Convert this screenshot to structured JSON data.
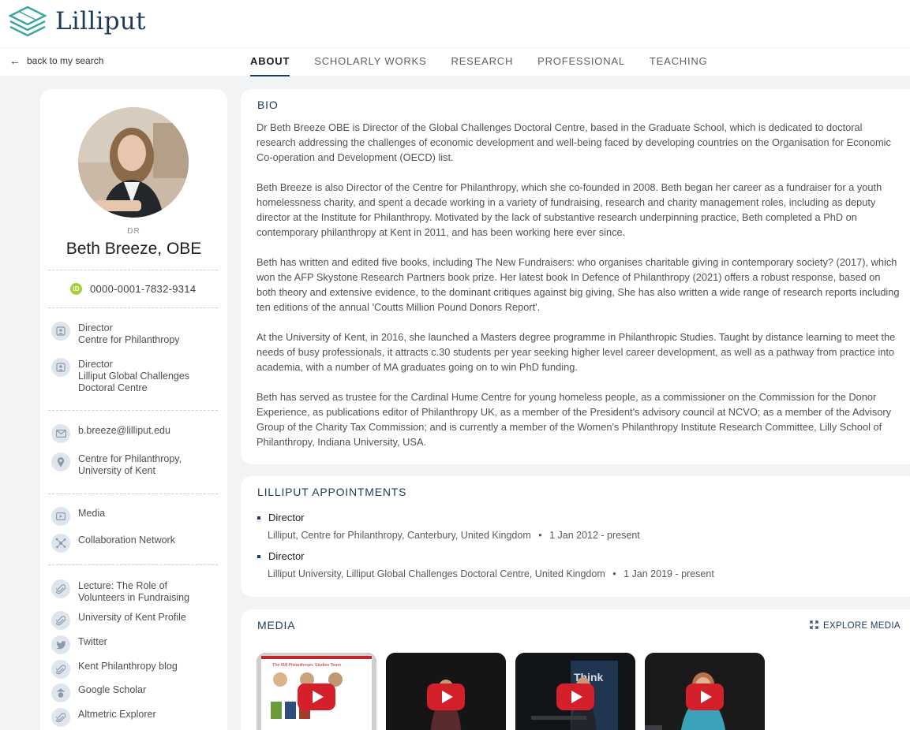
{
  "app": {
    "name": "Lilliput"
  },
  "nav": {
    "back_label": "back to my search",
    "tabs": [
      {
        "label": "ABOUT",
        "active": true
      },
      {
        "label": "SCHOLARLY WORKS",
        "active": false
      },
      {
        "label": "RESEARCH",
        "active": false
      },
      {
        "label": "PROFESSIONAL",
        "active": false
      },
      {
        "label": "TEACHING",
        "active": false
      }
    ]
  },
  "profile": {
    "salutation": "DR",
    "name": "Beth Breeze, OBE",
    "orcid_badge": "iD",
    "orcid": "0000-0001-7832-9314",
    "positions": [
      {
        "lines": [
          "Director",
          "Centre for Philanthropy"
        ]
      },
      {
        "lines": [
          "Director",
          "Lilliput Global Challenges",
          "Doctoral Centre"
        ]
      }
    ],
    "email": "b.breeze@lilliput.edu",
    "location": [
      "Centre for Philanthropy,",
      "University of Kent"
    ],
    "media_link": "Media",
    "network_link": "Collaboration Network",
    "links": [
      {
        "label": [
          "Lecture: The Role of",
          "Volunteers in Fundraising"
        ],
        "icon": "paperclip-icon"
      },
      {
        "label": [
          "University of Kent Profile"
        ],
        "icon": "paperclip-icon"
      },
      {
        "label": [
          "Twitter"
        ],
        "icon": "twitter-icon"
      },
      {
        "label": [
          "Kent Philanthropy blog"
        ],
        "icon": "paperclip-icon"
      },
      {
        "label": [
          "Google Scholar"
        ],
        "icon": "google-scholar-icon"
      },
      {
        "label": [
          "Altmetric Explorer"
        ],
        "icon": "paperclip-icon"
      }
    ]
  },
  "bio": {
    "title": "BIO",
    "paragraphs": [
      "Dr Beth Breeze OBE is Director of the Global Challenges Doctoral Centre, based in the Graduate School, which is dedicated to doctoral research addressing the challenges of economic development and well-being faced by developing countries on the Organisation for Economic Co-operation and Development (OECD) list.",
      "Beth Breeze is also Director of the Centre for Philanthropy, which she co-founded in 2008. Beth began her career as a fundraiser for a youth homelessness charity, and spent a decade working in a variety of fundraising, research and charity management roles, including as deputy director at the Institute for Philanthropy. Motivated by the lack of substantive research underpinning practice, Beth completed a PhD on contemporary philanthropy at Kent in 2011, and has been working here ever since.",
      "Beth has written and edited five books, including The New Fundraisers: who organises charitable giving in contemporary society? (2017), which won the AFP Skystone Research Partners book prize. Her latest book In Defence of Philanthropy (2021) offers a robust response, based on both theory and extensive evidence, to the dominant critiques against big giving, She has also written a wide range of research reports including ten editions of the annual 'Coutts Million Pound Donors Report'.",
      "At the University of Kent, in 2016, she launched a Masters degree programme in Philanthropic Studies. Taught by distance learning to meet the needs of busy professionals, it attracts c.30 students per year seeking higher level career development, as well as a pathway from practice into academia, with a number of MA graduates going on to win PhD funding.",
      "Beth has served as trustee for the Cardinal Hume Centre for young homeless people, as a commissioner on the Commission for the Donor Experience, as publications editor of Philanthropy UK, as a member of the President's advisory council at NCVO; as a member of the Advisory Group of the Charity Tax Commission; and is currently a member of the Women's Philanthropy Institute Research Committee, Lilly School of Philanthropy, Indiana University, USA."
    ]
  },
  "appointments": {
    "title": "LILLIPUT APPOINTMENTS",
    "items": [
      {
        "role": "Director",
        "org": "Lilliput, Centre for Philanthropy, Canterbury, United Kingdom",
        "sep": "•",
        "dates": "1 Jan 2012 - present"
      },
      {
        "role": "Director",
        "org": "Lilliput University, Lilliput Global Challenges Doctoral Centre, United Kingdom",
        "sep": "•",
        "dates": "1 Jan 2019 - present"
      }
    ]
  },
  "media": {
    "title": "MEDIA",
    "explore_label": "EXPLORE MEDIA",
    "thumb_texts": {
      "slide_title": "The MA Philanthropic Studies Team",
      "stage_text": "Think"
    },
    "colors": {
      "play": "#d3202a",
      "accent": "#1f3b5b",
      "orcid": "#a6ce39"
    }
  }
}
